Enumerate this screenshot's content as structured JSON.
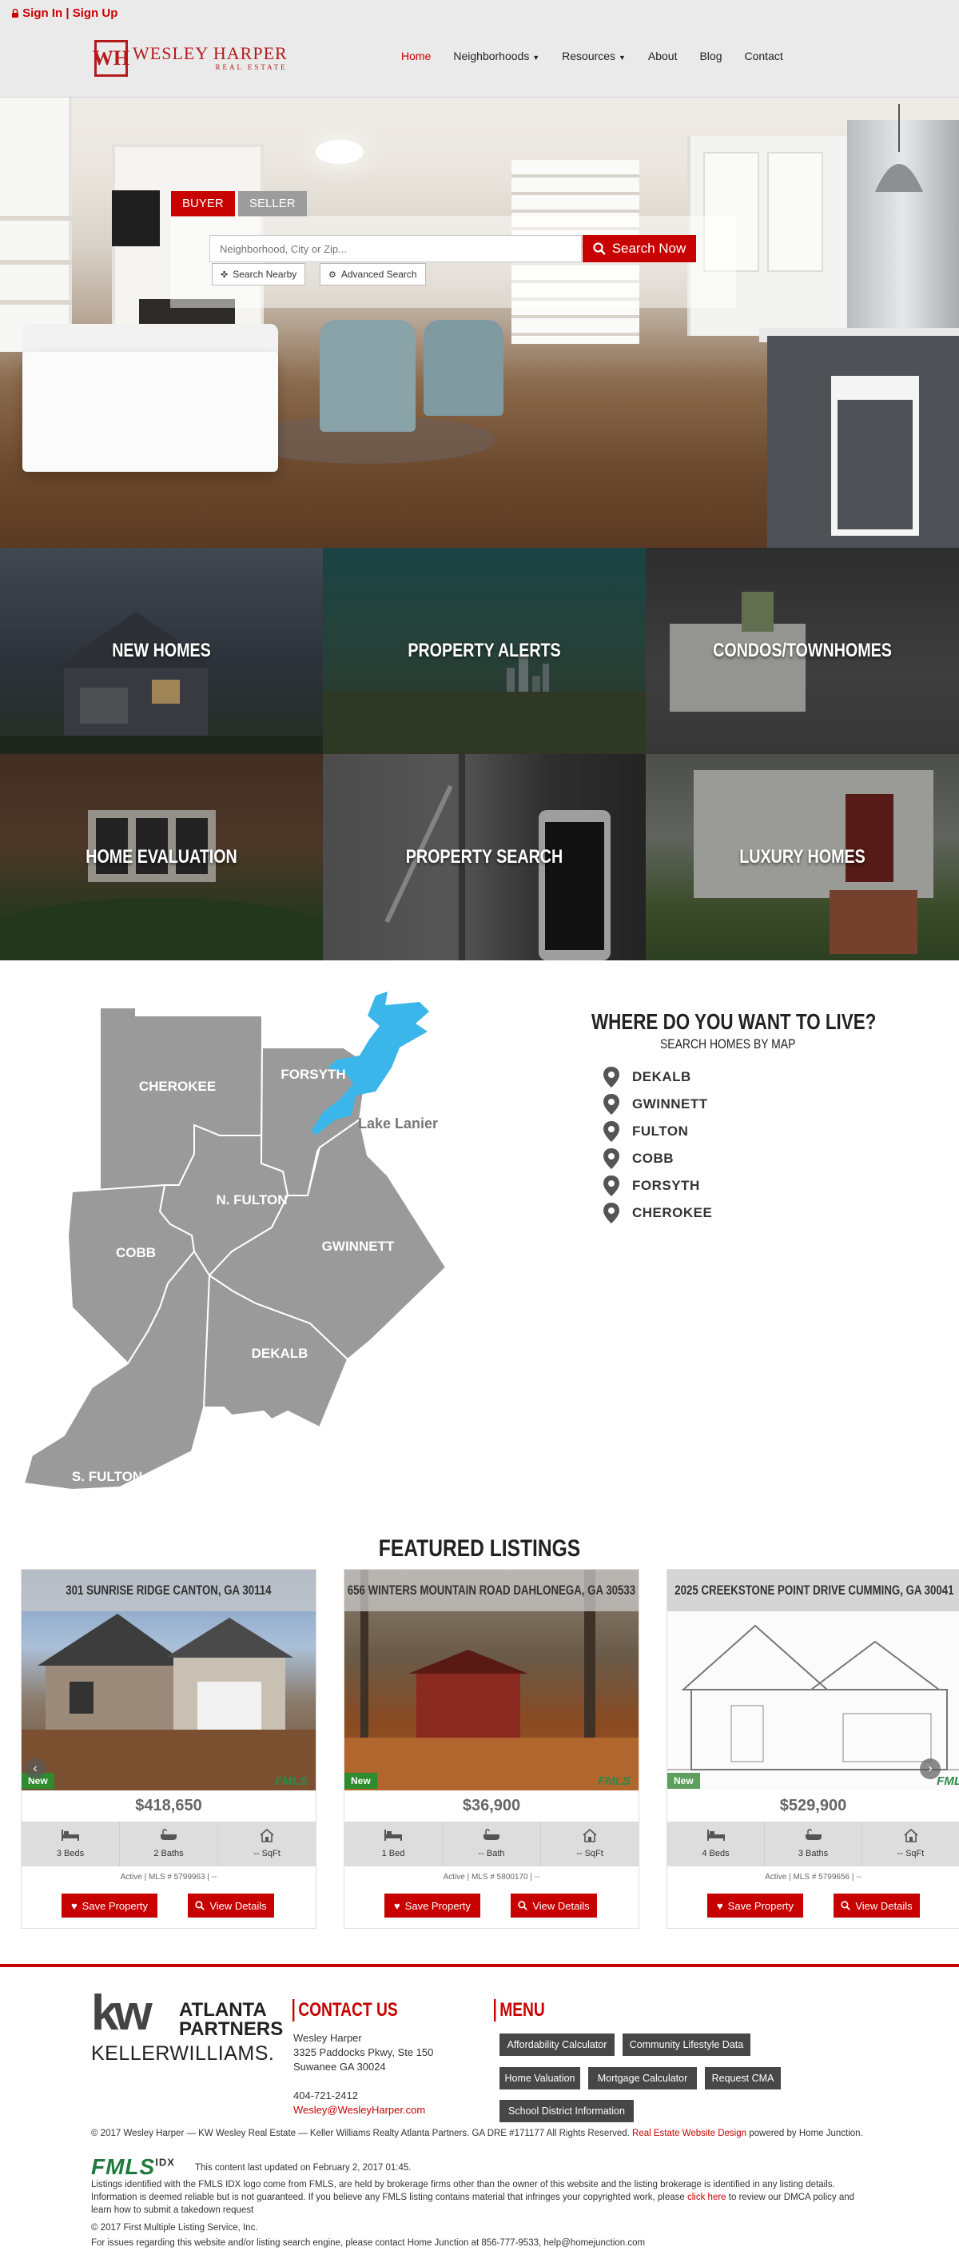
{
  "header": {
    "sign_in": "Sign In",
    "separator": "|",
    "sign_up": "Sign Up",
    "logo_initials": "WH",
    "logo_name": "WESLEY HARPER",
    "logo_sub": "REAL ESTATE",
    "nav": [
      {
        "label": "Home",
        "active": true
      },
      {
        "label": "Neighborhoods",
        "dropdown": true
      },
      {
        "label": "Resources",
        "dropdown": true
      },
      {
        "label": "About"
      },
      {
        "label": "Blog"
      },
      {
        "label": "Contact"
      }
    ]
  },
  "search": {
    "tab_buyer": "BUYER",
    "tab_seller": "SELLER",
    "placeholder": "Neighborhood, City or Zip...",
    "button": "Search Now",
    "nearby": "Search Nearby",
    "advanced": "Advanced Search"
  },
  "tiles": [
    {
      "label": "NEW HOMES"
    },
    {
      "label": "PROPERTY ALERTS"
    },
    {
      "label": "CONDOS/TOWNHOMES"
    },
    {
      "label": "HOME EVALUATION"
    },
    {
      "label": "PROPERTY SEARCH"
    },
    {
      "label": "LUXURY HOMES"
    }
  ],
  "map": {
    "regions": [
      "CHEROKEE",
      "FORSYTH",
      "N. FULTON",
      "COBB",
      "GWINNETT",
      "DEKALB",
      "S. FULTON"
    ],
    "lake": "Lake Lanier"
  },
  "live": {
    "title": "WHERE DO YOU WANT TO LIVE?",
    "subtitle": "SEARCH HOMES BY MAP",
    "areas": [
      "DEKALB",
      "GWINNETT",
      "FULTON",
      "COBB",
      "FORSYTH",
      "CHEROKEE"
    ]
  },
  "featured": {
    "title": "FEATURED LISTINGS",
    "new_badge": "New",
    "fmls_badge": "FMLS",
    "save_label": "Save Property",
    "view_label": "View Details",
    "listings": [
      {
        "address": "301 SUNRISE RIDGE CANTON, GA 30114",
        "price": "$418,650",
        "beds": "3 Beds",
        "baths": "2 Baths",
        "sqft": "-- SqFt",
        "mls": "Active | MLS # 5799963 | --"
      },
      {
        "address": "656 WINTERS MOUNTAIN ROAD DAHLONEGA, GA 30533",
        "price": "$36,900",
        "beds": "1 Bed",
        "baths": "-- Bath",
        "sqft": "-- SqFt",
        "mls": "Active | MLS # 5800170 | --"
      },
      {
        "address": "2025 CREEKSTONE POINT DRIVE CUMMING, GA 30041",
        "price": "$529,900",
        "beds": "4 Beds",
        "baths": "3 Baths",
        "sqft": "-- SqFt",
        "mls": "Active | MLS # 5799656 | --"
      }
    ]
  },
  "footer": {
    "kw_big": "kw",
    "kw_atlanta": "ATLANTA",
    "kw_partners": "PARTNERS",
    "kw_keller": "KELLERWILLIAMS.",
    "contact_title": "CONTACT US",
    "contact_name": "Wesley Harper",
    "contact_addr1": "3325 Paddocks Pkwy, Ste 150",
    "contact_addr2": "Suwanee GA 30024",
    "contact_phone": "404-721-2412",
    "contact_email": "Wesley@WesleyHarper.com",
    "menu_title": "MENU",
    "menu": [
      "Affordability Calculator",
      "Community Lifestyle Data",
      "Home Valuation",
      "Mortgage Calculator",
      "Request CMA",
      "School District Information"
    ],
    "copyright": "© 2017 Wesley Harper — KW Wesley Real Estate — Keller Williams Realty Atlanta Partners. GA DRE #171177 All Rights Reserved.",
    "website_design": "Real Estate Website Design",
    "powered_by": "powered by Home Junction.",
    "fmls_logo": "FMLS",
    "fmls_idx": "IDX",
    "updated": "This content last updated on February 2, 2017 01:45.",
    "disclaimer_a": "Listings identified with the FMLS IDX logo come from FMLS, are held by brokerage firms other than the owner of this website and the listing brokerage is identified in any listing details. Information is deemed reliable but is not guaranteed. If you believe any FMLS listing contains material that infringes your copyrighted work, please",
    "click_here": "click here",
    "disclaimer_b": "to review our DMCA policy and learn how to submit a takedown request",
    "fmls_copyright": "© 2017 First Multiple Listing Service, Inc.",
    "issues": "For issues regarding this website and/or listing search engine, please contact Home Junction at 856-777-9533, help@homejunction.com"
  }
}
